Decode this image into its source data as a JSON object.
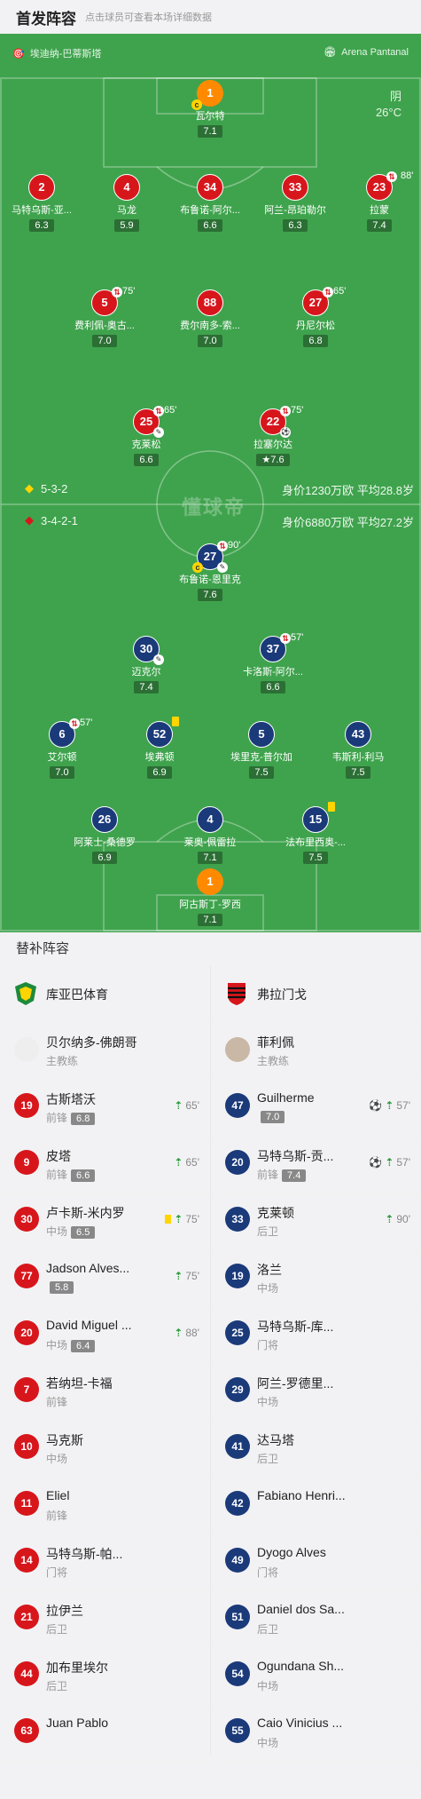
{
  "header": {
    "title": "首发阵容",
    "subtitle": "点击球员可查看本场详细数据"
  },
  "venue": {
    "left": "埃迪纳-巴蒂斯塔",
    "right": "Arena Pantanal"
  },
  "weather": {
    "condition": "阴",
    "temp": "26°C"
  },
  "watermark": "懂球帝",
  "teams": {
    "home": {
      "formation": "5-3-2",
      "value": "身价1230万欧 平均28.8岁"
    },
    "away": {
      "formation": "3-4-2-1",
      "value": "身价6880万欧 平均27.2岁"
    }
  },
  "home_players": [
    {
      "num": "1",
      "name": "瓦尔特",
      "rating": "7.1"
    },
    {
      "num": "2",
      "name": "马特乌斯-亚...",
      "rating": "6.3"
    },
    {
      "num": "4",
      "name": "马龙",
      "rating": "5.9"
    },
    {
      "num": "34",
      "name": "布鲁诺-阿尔...",
      "rating": "6.6"
    },
    {
      "num": "33",
      "name": "阿兰-昂珀勒尔",
      "rating": "6.3"
    },
    {
      "num": "23",
      "name": "拉蒙",
      "rating": "7.4",
      "sub": "88'"
    },
    {
      "num": "5",
      "name": "费利佩-奥古...",
      "rating": "7.0",
      "sub": "75'"
    },
    {
      "num": "88",
      "name": "费尔南多-索...",
      "rating": "7.0"
    },
    {
      "num": "27",
      "name": "丹尼尔松",
      "rating": "6.8",
      "sub": "65'"
    },
    {
      "num": "25",
      "name": "克莱松",
      "rating": "6.6",
      "sub": "65'"
    },
    {
      "num": "22",
      "name": "拉塞尔达",
      "rating": "7.6",
      "sub": "75'"
    }
  ],
  "away_players": [
    {
      "num": "27",
      "name": "布鲁诺-恩里克",
      "rating": "7.6",
      "sub": "90'"
    },
    {
      "num": "30",
      "name": "迈克尔",
      "rating": "7.4"
    },
    {
      "num": "37",
      "name": "卡洛斯-阿尔...",
      "rating": "6.6",
      "sub": "57'"
    },
    {
      "num": "6",
      "name": "艾尔顿",
      "rating": "7.0",
      "sub": "57'"
    },
    {
      "num": "52",
      "name": "埃弗顿",
      "rating": "6.9"
    },
    {
      "num": "5",
      "name": "埃里克-普尔加",
      "rating": "7.5"
    },
    {
      "num": "43",
      "name": "韦斯利-利马",
      "rating": "7.5"
    },
    {
      "num": "26",
      "name": "阿莱士-桑德罗",
      "rating": "6.9"
    },
    {
      "num": "4",
      "name": "莱奥-佩雷拉",
      "rating": "7.1"
    },
    {
      "num": "15",
      "name": "法布里西奥-...",
      "rating": "7.5"
    },
    {
      "num": "1",
      "name": "阿古斯丁-罗西",
      "rating": "7.1"
    }
  ],
  "subs_title": "替补阵容",
  "subs": {
    "home": {
      "team": "库亚巴体育",
      "coach": {
        "name": "贝尔纳多-佛朗哥",
        "role": "主教练"
      },
      "players": [
        {
          "num": "19",
          "name": "古斯塔沃",
          "pos": "前锋",
          "rating": "6.8",
          "min": "65'"
        },
        {
          "num": "9",
          "name": "皮塔",
          "pos": "前锋",
          "rating": "6.6",
          "min": "65'"
        },
        {
          "num": "30",
          "name": "卢卡斯-米内罗",
          "pos": "中场",
          "rating": "6.5",
          "min": "75'",
          "yellow": true
        },
        {
          "num": "77",
          "name": "Jadson Alves...",
          "pos": "",
          "rating": "5.8",
          "min": "75'"
        },
        {
          "num": "20",
          "name": "David Miguel ...",
          "pos": "中场",
          "rating": "6.4",
          "min": "88'"
        },
        {
          "num": "7",
          "name": "若纳坦-卡福",
          "pos": "前锋"
        },
        {
          "num": "10",
          "name": "马克斯",
          "pos": "中场"
        },
        {
          "num": "11",
          "name": "Eliel",
          "pos": "前锋"
        },
        {
          "num": "14",
          "name": "马特乌斯-帕...",
          "pos": "门将"
        },
        {
          "num": "21",
          "name": "拉伊兰",
          "pos": "后卫"
        },
        {
          "num": "44",
          "name": "加布里埃尔",
          "pos": "后卫"
        },
        {
          "num": "63",
          "name": "Juan Pablo",
          "pos": ""
        }
      ]
    },
    "away": {
      "team": "弗拉门戈",
      "coach": {
        "name": "菲利佩",
        "role": "主教练"
      },
      "players": [
        {
          "num": "47",
          "name": "Guilherme",
          "pos": "",
          "rating": "7.0",
          "min": "57'",
          "goal": true
        },
        {
          "num": "20",
          "name": "马特乌斯-贡...",
          "pos": "前锋",
          "rating": "7.4",
          "min": "57'",
          "goal": true
        },
        {
          "num": "33",
          "name": "克莱顿",
          "pos": "后卫",
          "min": "90'"
        },
        {
          "num": "19",
          "name": "洛兰",
          "pos": "中场"
        },
        {
          "num": "25",
          "name": "马特乌斯-库...",
          "pos": "门将"
        },
        {
          "num": "29",
          "name": "阿兰-罗德里...",
          "pos": "中场"
        },
        {
          "num": "41",
          "name": "达马塔",
          "pos": "后卫"
        },
        {
          "num": "42",
          "name": "Fabiano Henri...",
          "pos": ""
        },
        {
          "num": "49",
          "name": "Dyogo Alves",
          "pos": "门将"
        },
        {
          "num": "51",
          "name": "Daniel dos Sa...",
          "pos": "后卫"
        },
        {
          "num": "54",
          "name": "Ogundana Sh...",
          "pos": "中场"
        },
        {
          "num": "55",
          "name": "Caio Vinicius ...",
          "pos": "中场"
        }
      ]
    }
  }
}
